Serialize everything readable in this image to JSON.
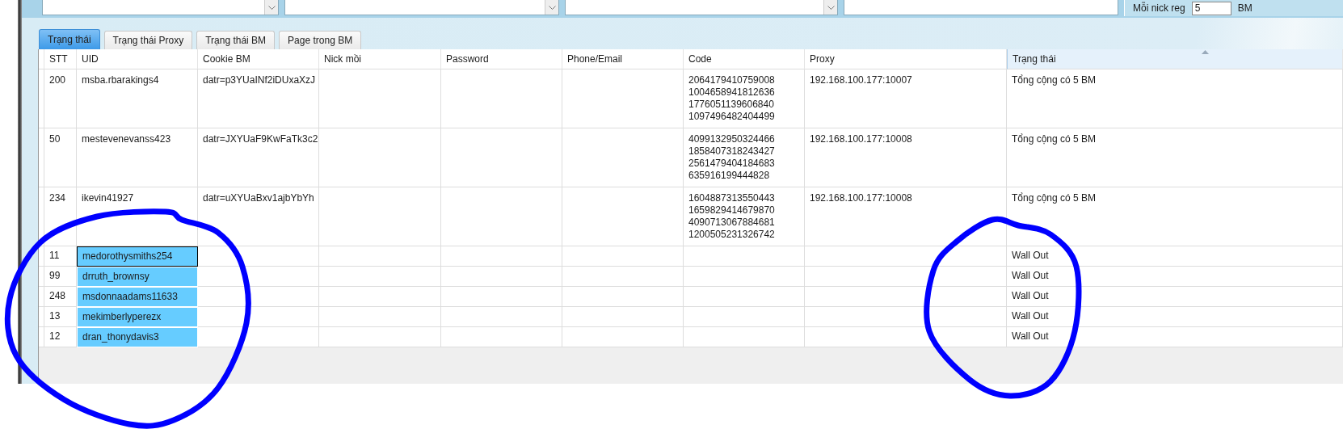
{
  "top_bar": {
    "reg_label": "Mỗi nick reg",
    "reg_value": "5",
    "reg_unit": "BM"
  },
  "tabs": [
    {
      "label": "Trạng thái",
      "selected": true
    },
    {
      "label": "Trạng thái Proxy",
      "selected": false
    },
    {
      "label": "Trạng thái BM",
      "selected": false
    },
    {
      "label": "Page trong BM",
      "selected": false
    }
  ],
  "table": {
    "columns": [
      {
        "label": "STT",
        "sorted": false
      },
      {
        "label": "UID",
        "sorted": false
      },
      {
        "label": "Cookie BM",
        "sorted": false
      },
      {
        "label": "Nick mồi",
        "sorted": false
      },
      {
        "label": "Password",
        "sorted": false
      },
      {
        "label": "Phone/Email",
        "sorted": false
      },
      {
        "label": "Code",
        "sorted": false
      },
      {
        "label": "Proxy",
        "sorted": false
      },
      {
        "label": "Trạng thái",
        "sorted": true
      }
    ],
    "rows": [
      {
        "stt": "200",
        "uid": "msba.rbarakings4",
        "cookie": "datr=p3YUaINf2iDUxaXzJ",
        "code": [
          "2064179410759008",
          "1004658941812636",
          "1776051139606840",
          "1097496482404499"
        ],
        "proxy": "192.168.100.177:10007",
        "status": "Tổng cộng có 5 BM",
        "selected": false,
        "focused": false
      },
      {
        "stt": "50",
        "uid": "mestevenevanss423",
        "cookie": "datr=JXYUaF9KwFaTk3c2",
        "code": [
          "4099132950324466",
          "1858407318243427",
          "2561479404184683",
          "635916199444828"
        ],
        "proxy": "192.168.100.177:10008",
        "status": "Tổng cộng có 5 BM",
        "selected": false,
        "focused": false
      },
      {
        "stt": "234",
        "uid": "ikevin41927",
        "cookie": "datr=uXYUaBxv1ajbYbYh",
        "code": [
          "1604887313550443",
          "1659829414679870",
          "4090713067884681",
          "1200505231326742"
        ],
        "proxy": "192.168.100.177:10008",
        "status": "Tổng cộng có 5 BM",
        "selected": false,
        "focused": false
      },
      {
        "stt": "11",
        "uid": "medorothysmiths254",
        "status": "Wall Out",
        "selected": true,
        "focused": true
      },
      {
        "stt": "99",
        "uid": "drruth_brownsy",
        "status": "Wall Out",
        "selected": true,
        "focused": false
      },
      {
        "stt": "248",
        "uid": "msdonnaadams11633",
        "status": "Wall Out",
        "selected": true,
        "focused": false
      },
      {
        "stt": "13",
        "uid": "mekimberlyperezx",
        "status": "Wall Out",
        "selected": true,
        "focused": false
      },
      {
        "stt": "12",
        "uid": "dran_thonydavis3",
        "status": "Wall Out",
        "selected": true,
        "focused": false
      }
    ]
  }
}
